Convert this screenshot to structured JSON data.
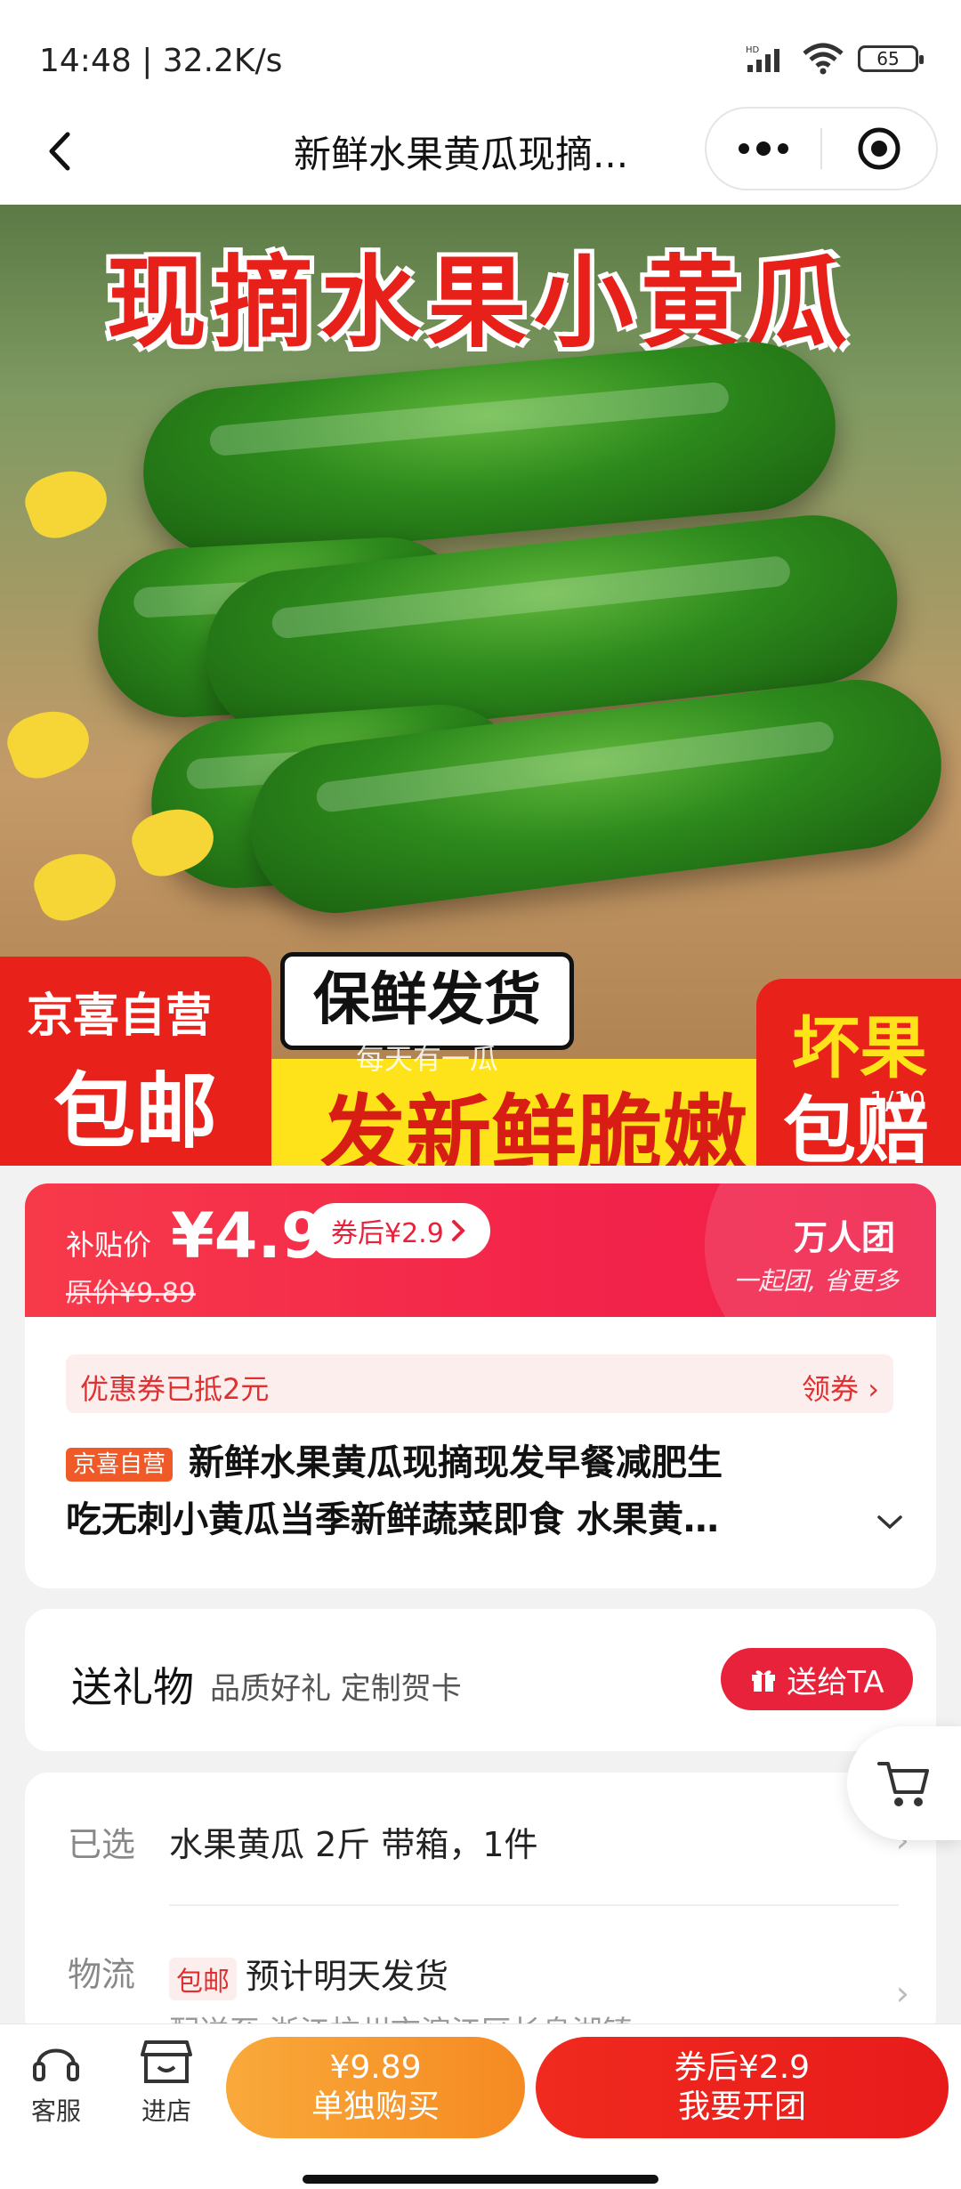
{
  "status": {
    "time_speed": "14:48 | 32.2K/s",
    "net_label": "HD",
    "battery": "65"
  },
  "nav": {
    "title": "新鲜水果黄瓜现摘..."
  },
  "hero": {
    "headline": "现摘水果小黄瓜",
    "badge_jx_line1": "京喜自营",
    "badge_jx_line2": "包邮",
    "badge_fresh": "保鲜发货",
    "faint_text": "每天有一瓜",
    "slogan": "新鲜脆嫩",
    "slogan_prefix": "发",
    "badge_bad_line1": "坏果",
    "badge_bad_line2": "包赔",
    "pager": "1/10"
  },
  "price": {
    "label": "补贴价",
    "value": "¥4.9",
    "original": "原价¥9.89",
    "coupon_pill": "券后¥2.9",
    "group_title": "万人团",
    "group_sub": "一起团, 省更多"
  },
  "info": {
    "coupon_left": "优惠券已抵2元",
    "coupon_right": "领券",
    "tag": "京喜自营",
    "title_line1": "新鲜水果黄瓜现摘现发早餐减肥生",
    "title_line2": "吃无刺小黄瓜当季新鲜蔬菜即食 水果黄…"
  },
  "gift": {
    "title": "送礼物",
    "subtitle": "品质好礼 定制贺卡",
    "button": "送给TA"
  },
  "selection": {
    "selected_label": "已选",
    "selected_value": "水果黄瓜 2斤 带箱，1件",
    "shipping_label": "物流",
    "shipping_tag": "包邮",
    "shipping_value": "预计明天发货",
    "address": "配送至 浙江杭州市滨江区长息湖镇"
  },
  "bottom": {
    "service": "客服",
    "store": "进店",
    "solo_price": "¥9.89",
    "solo_label": "单独购买",
    "group_price": "券后¥2.9",
    "group_label": "我要开团"
  }
}
